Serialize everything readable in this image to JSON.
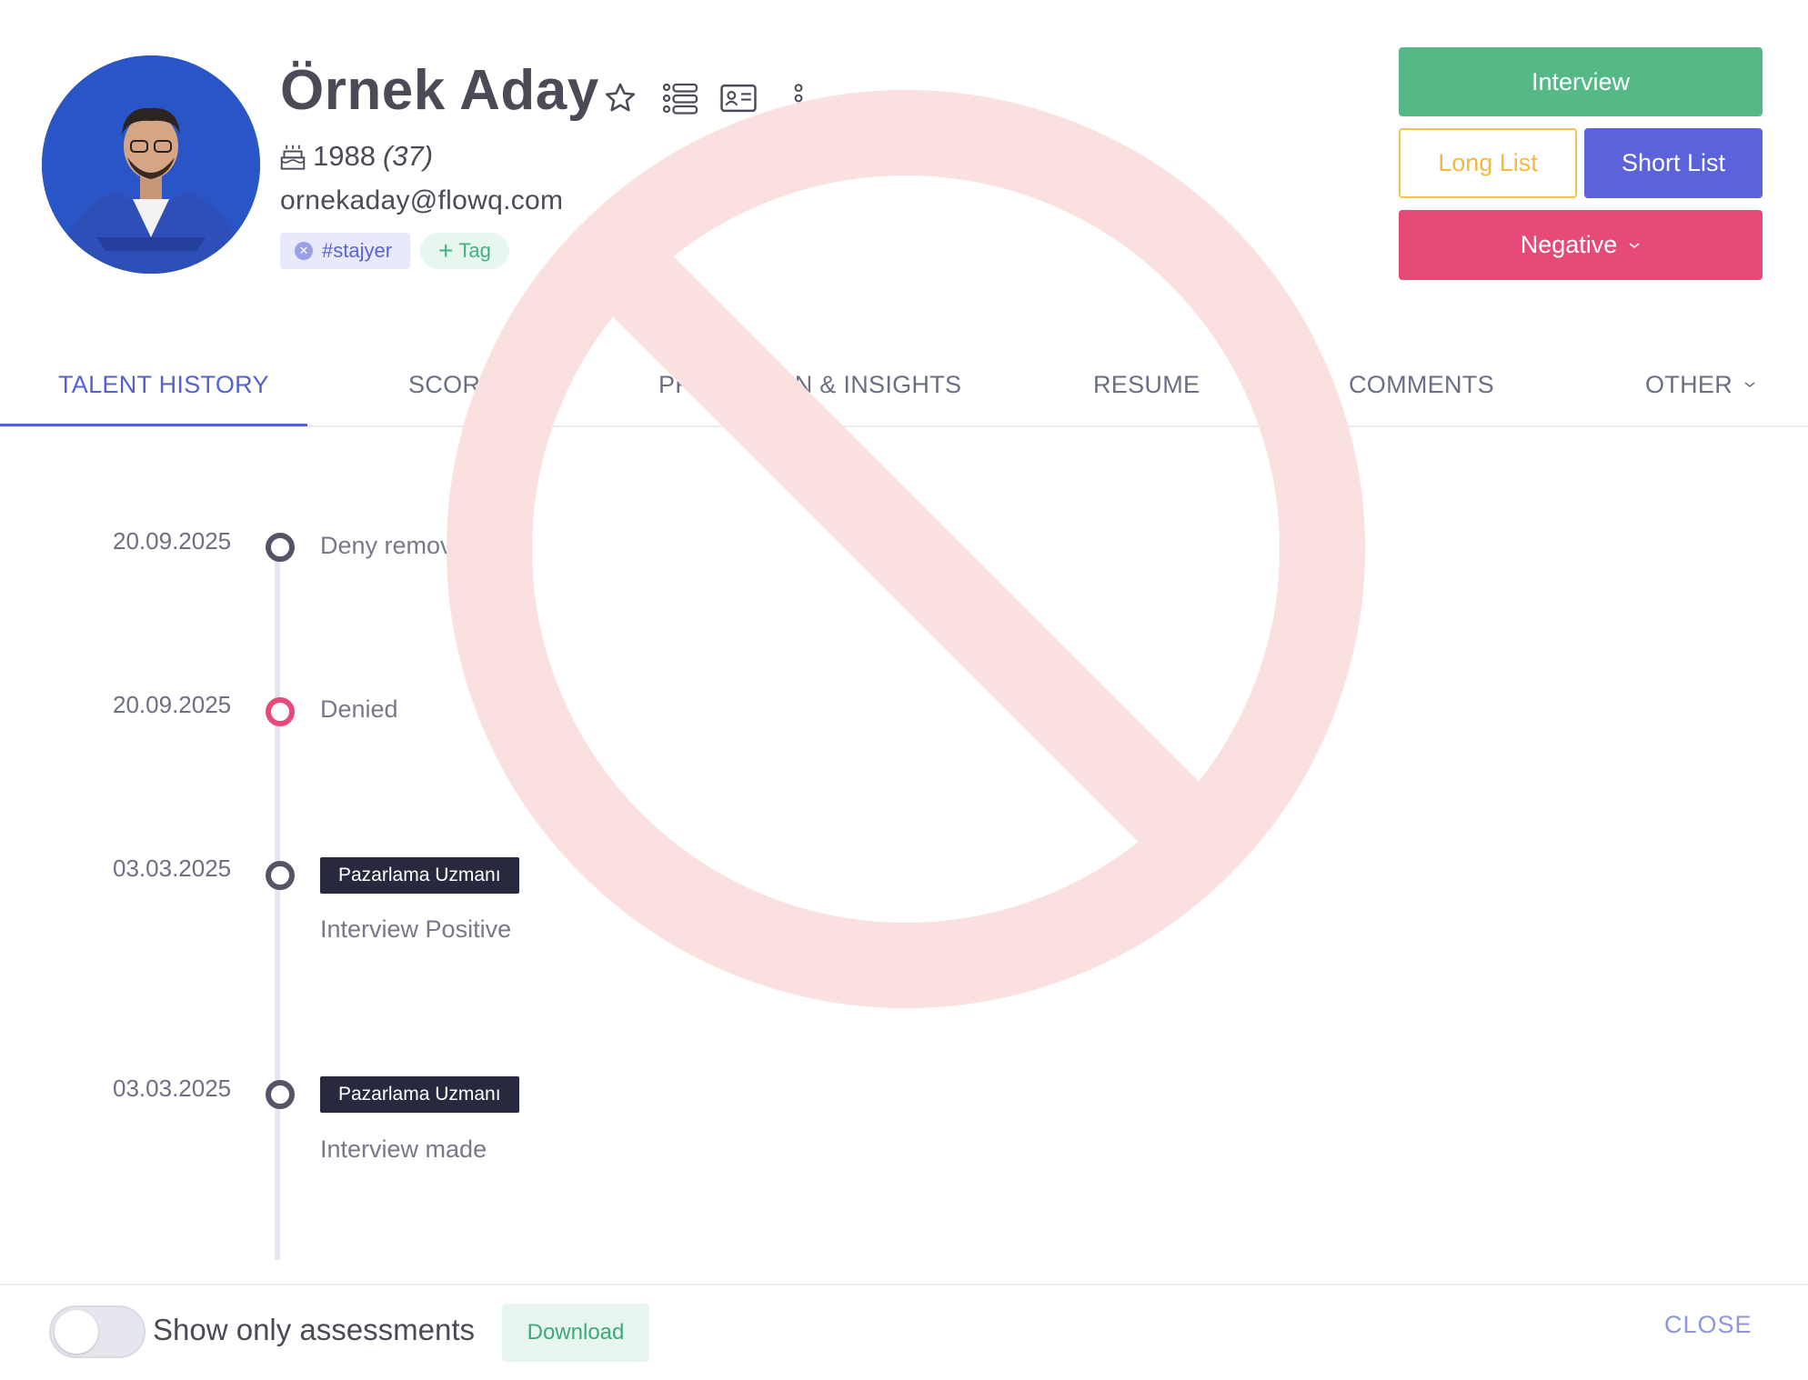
{
  "profile": {
    "name": "Örnek Aday",
    "birth_year": "1988",
    "age": "(37)",
    "email": "ornekaday@flowq.com",
    "tags": [
      {
        "label": "#stajyer"
      }
    ],
    "add_tag_label": "Tag",
    "icons": [
      "star-icon",
      "list-people-icon",
      "id-card-icon",
      "more-vertical-icon"
    ]
  },
  "actions": {
    "interview": "Interview",
    "long_list": "Long List",
    "short_list": "Short List",
    "negative": "Negative"
  },
  "tabs": [
    {
      "label": "TALENT HISTORY",
      "active": true
    },
    {
      "label": "SCORES"
    },
    {
      "label": "PREDICTION & INSIGHTS"
    },
    {
      "label": "RESUME"
    },
    {
      "label": "COMMENTS"
    },
    {
      "label": "OTHER"
    }
  ],
  "timeline": [
    {
      "date": "20.09.2025",
      "text": "Deny removed",
      "status": "neutral"
    },
    {
      "date": "20.09.2025",
      "text": "Denied",
      "status": "negative"
    },
    {
      "date": "03.03.2025",
      "badge": "Pazarlama Uzmanı",
      "text": "Interview Positive",
      "status": "neutral"
    },
    {
      "date": "03.03.2025",
      "badge": "Pazarlama Uzmanı",
      "text": "Interview made",
      "status": "neutral"
    }
  ],
  "footer": {
    "toggle_label": "Show only assessments",
    "toggle_on": false,
    "download": "Download",
    "close": "CLOSE"
  },
  "colors": {
    "primary": "#5561d1",
    "success": "#55b887",
    "warning": "#f5b83a",
    "danger": "#e84a78",
    "watermark": "#f8d5d5"
  }
}
